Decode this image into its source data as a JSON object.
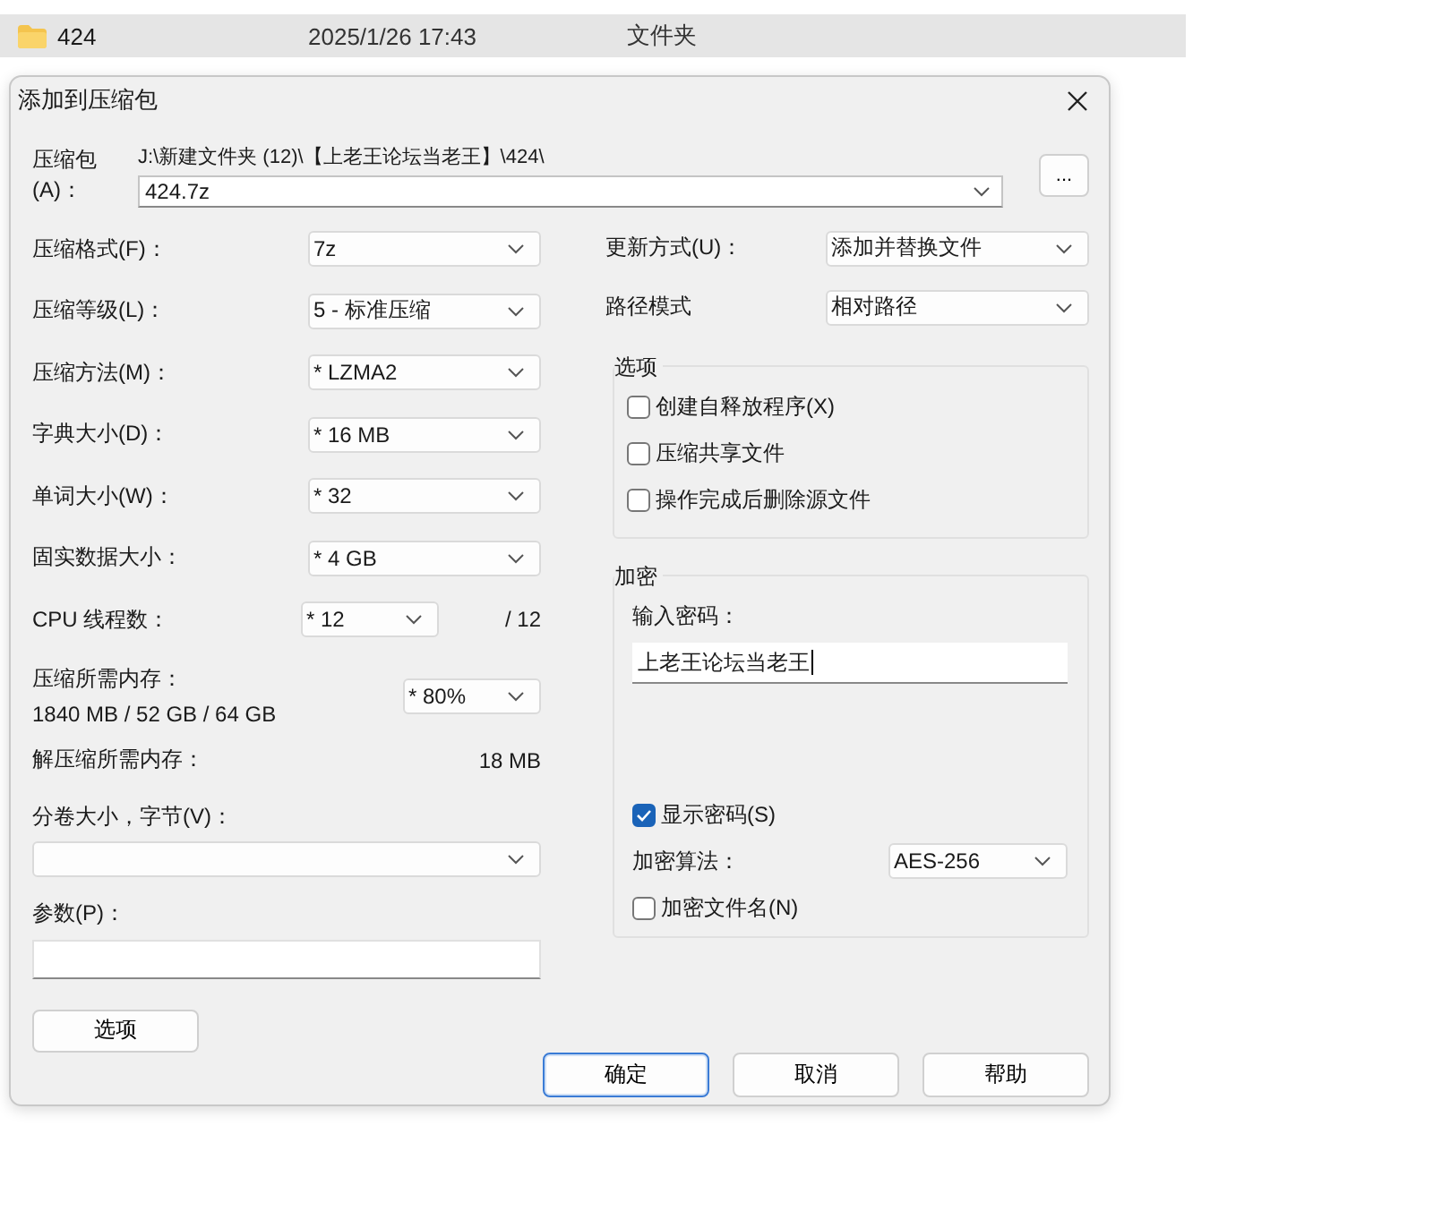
{
  "explorer_row": {
    "name": "424",
    "date": "2025/1/26 17:43",
    "type": "文件夹",
    "selected": true
  },
  "window": {
    "title": "添加到压缩包"
  },
  "archive": {
    "label": "压缩包(A)：",
    "path": "J:\\新建文件夹 (12)\\【上老王论坛当老王】\\424\\",
    "value": "424.7z",
    "browse": "..."
  },
  "left_fields": [
    {
      "kind": "select",
      "label": "压缩格式(F)：",
      "value": "7z"
    },
    {
      "kind": "select",
      "label": "压缩等级(L)：",
      "value": "5 - 标准压缩"
    },
    {
      "kind": "select",
      "label": "压缩方法(M)：",
      "value": "* LZMA2"
    },
    {
      "kind": "select",
      "label": "字典大小(D)：",
      "value": "* 16 MB"
    },
    {
      "kind": "select",
      "label": "单词大小(W)：",
      "value": "* 32"
    },
    {
      "kind": "select",
      "label": "固实数据大小：",
      "value": "* 4 GB"
    },
    {
      "kind": "cpu",
      "label": "CPU 线程数：",
      "value": "* 12",
      "suffix": "/ 12"
    },
    {
      "kind": "memory",
      "label": "压缩所需内存：",
      "detail": "1840 MB / 52 GB / 64 GB",
      "value": "* 80%"
    },
    {
      "kind": "info",
      "label": "解压缩所需内存：",
      "value": "18 MB"
    },
    {
      "kind": "wide_select",
      "label": "分卷大小，字节(V)："
    },
    {
      "kind": "wide_input",
      "label": "参数(P)："
    }
  ],
  "options_button": "选项",
  "right_fields": [
    {
      "label": "更新方式(U)：",
      "value": "添加并替换文件"
    },
    {
      "label": "路径模式",
      "value": "相对路径"
    }
  ],
  "options_group": {
    "title": "选项",
    "checkboxes": [
      {
        "label": "创建自释放程序(X)",
        "checked": false
      },
      {
        "label": "压缩共享文件",
        "checked": false
      },
      {
        "label": "操作完成后删除源文件",
        "checked": false
      }
    ]
  },
  "encryption": {
    "title": "加密",
    "password_label": "输入密码：",
    "password": "上老王论坛当老王",
    "show_password": {
      "label": "显示密码(S)",
      "checked": true
    },
    "method_label": "加密算法：",
    "method": "AES-256",
    "encrypt_names": {
      "label": "加密文件名(N)",
      "checked": false
    }
  },
  "buttons": [
    {
      "label": "确定",
      "default": true
    },
    {
      "label": "取消",
      "default": false
    },
    {
      "label": "帮助",
      "default": false
    }
  ]
}
